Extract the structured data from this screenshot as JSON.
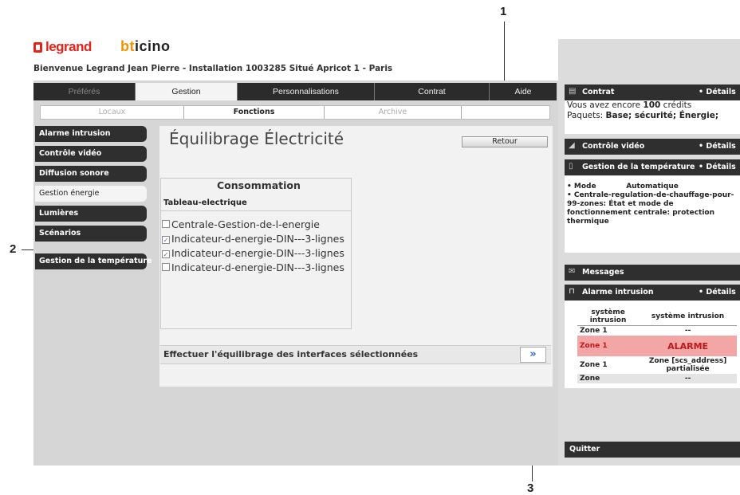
{
  "callouts": [
    "1",
    "2",
    "3"
  ],
  "header": {
    "logo_legrand": "legrand",
    "logo_bticino_1": "bt",
    "logo_bticino_2": "icino",
    "welcome": "Bienvenue Legrand Jean Pierre - Installation 1003285 Situé Apricot 1 - Paris"
  },
  "nav": {
    "tabs": [
      "Préférés",
      "Gestion",
      "Personnalisations",
      "Contrat",
      "Aide"
    ],
    "active": "Gestion"
  },
  "subnav": {
    "tabs": [
      "Locaux",
      "Fonctions",
      "Archive"
    ],
    "active": "Fonctions"
  },
  "sidebar": {
    "items": [
      "Alarme intrusion",
      "Contrôle vidéo",
      "Diffusion sonore",
      "Gestion énergie",
      "Lumières",
      "Scénarios",
      "Gestion de la température"
    ],
    "active": "Gestion énergie"
  },
  "main": {
    "title": "Équilibrage Électricité",
    "retour_label": "Retour",
    "consommation_title": "Consommation",
    "tableau_label": "Tableau-electrique",
    "options": [
      {
        "label": "Centrale-Gestion-de-l-energie",
        "checked": false
      },
      {
        "label": "Indicateur-d-energie-DIN---3-lignes",
        "checked": true
      },
      {
        "label": "Indicateur-d-energie-DIN---3-lignes",
        "checked": true
      },
      {
        "label": "Indicateur-d-energie-DIN---3-lignes",
        "checked": false
      }
    ],
    "balance_label": "Effectuer l'équilibrage des interfaces sélectionnées",
    "balance_button": "»"
  },
  "right": {
    "contrat": {
      "title": "Contrat",
      "details": "• Détails",
      "line1_prefix": "Vous avez encore ",
      "line1_credits": "100",
      "line1_suffix": " crédits",
      "line2_prefix": "Paquets: ",
      "line2_packs": "Base; sécurité; Énergie;"
    },
    "video": {
      "title": "Contrôle vidéo",
      "details": "• Détails"
    },
    "temperature": {
      "title": "Gestion de la température",
      "details": "• Détails",
      "mode_label": "• Mode",
      "mode_value": "Automatique",
      "text": "• Centrale-regulation-de-chauffage-pour-99-zones: État et mode de fonctionnement centrale: protection thermique"
    },
    "messages": {
      "title": "Messages"
    },
    "alarme": {
      "title": "Alarme intrusion",
      "details": "• Détails",
      "headers": [
        "système intrusion",
        "système intrusion"
      ],
      "rows": [
        {
          "zone": "Zone 1",
          "value": "--",
          "style": "plain"
        },
        {
          "zone": "Zone 1",
          "value": "ALARME",
          "style": "alarm"
        },
        {
          "zone": "Zone 1",
          "value": "Zone [scs_address] partialisée",
          "style": "plain"
        },
        {
          "zone": "Zone",
          "value": "--",
          "style": "grey"
        }
      ]
    },
    "quitter": "Quitter"
  },
  "colors": {
    "legrand_red": "#e2231a",
    "bticino_orange": "#f39200",
    "dark_bar": "#2f2f2f",
    "alarm_bg": "#f2a6a6",
    "alarm_text": "#c01818",
    "link_blue": "#2a6ac8"
  }
}
